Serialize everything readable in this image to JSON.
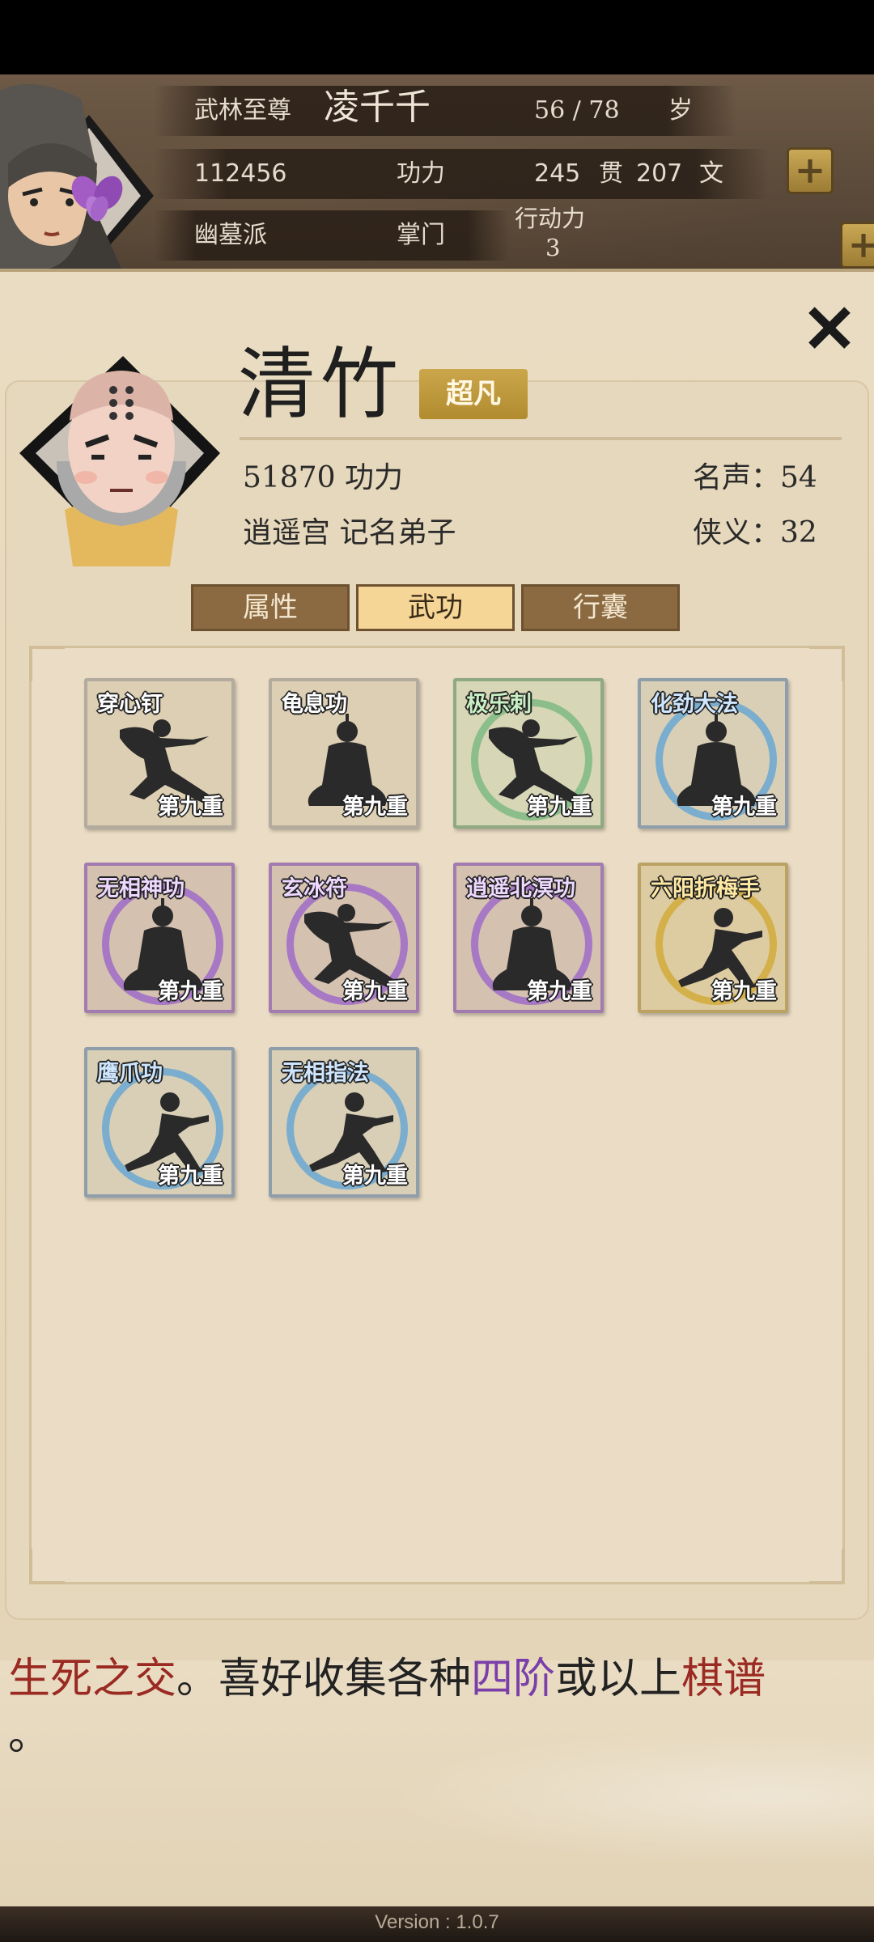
{
  "player": {
    "title": "武林至尊",
    "name": "凌千千",
    "age": "56 / 78",
    "age_unit": "岁",
    "power_value": "112456",
    "power_label": "功力",
    "money_guan": "245",
    "money_guan_unit": "贯",
    "money_wen": "207",
    "money_wen_unit": "文",
    "sect": "幽墓派",
    "sect_role": "掌门",
    "action_label": "行动力",
    "action_value": "3",
    "action_filled": 3,
    "action_total": 10,
    "plus_symbol": "+"
  },
  "npc": {
    "name": "清竹",
    "rank": "超凡",
    "power": "51870 功力",
    "affiliation": "逍遥宫 记名弟子",
    "fame": "名声：54",
    "chivalry": "侠义：32",
    "close_symbol": "✕"
  },
  "tabs": [
    {
      "label": "属性",
      "active": false
    },
    {
      "label": "武功",
      "active": true
    },
    {
      "label": "行囊",
      "active": false
    }
  ],
  "skills": [
    {
      "name": "穿心钉",
      "level": "第九重",
      "tier": "plain",
      "pose": "lunge"
    },
    {
      "name": "龟息功",
      "level": "第九重",
      "tier": "plain",
      "pose": "meditate"
    },
    {
      "name": "极乐刺",
      "level": "第九重",
      "tier": "green",
      "pose": "lunge"
    },
    {
      "name": "化劲大法",
      "level": "第九重",
      "tier": "blue",
      "pose": "meditate"
    },
    {
      "name": "无相神功",
      "level": "第九重",
      "tier": "purple",
      "pose": "meditate"
    },
    {
      "name": "玄冰符",
      "level": "第九重",
      "tier": "purple",
      "pose": "lunge"
    },
    {
      "name": "逍遥北溟功",
      "level": "第九重",
      "tier": "purple",
      "pose": "meditate"
    },
    {
      "name": "六阳折梅手",
      "level": "第九重",
      "tier": "gold",
      "pose": "stance"
    },
    {
      "name": "鹰爪功",
      "level": "第九重",
      "tier": "blue",
      "pose": "stance"
    },
    {
      "name": "无相指法",
      "level": "第九重",
      "tier": "blue",
      "pose": "stance"
    }
  ],
  "description": {
    "part1": "生死之交",
    "part2": "。喜好收集各种",
    "part3": "四阶",
    "part4": "或以上",
    "part5": "棋谱",
    "part6": "。"
  },
  "version": "Version : 1.0.7",
  "colors": {
    "accent_gold": "#cba64a",
    "tab_active": "#f6d696",
    "tab_inactive": "#8b6a42",
    "tier_green": "#7fba84",
    "tier_blue": "#6aa7d2",
    "tier_purple": "#9f6bc8",
    "tier_gold": "#d2ac3c"
  }
}
